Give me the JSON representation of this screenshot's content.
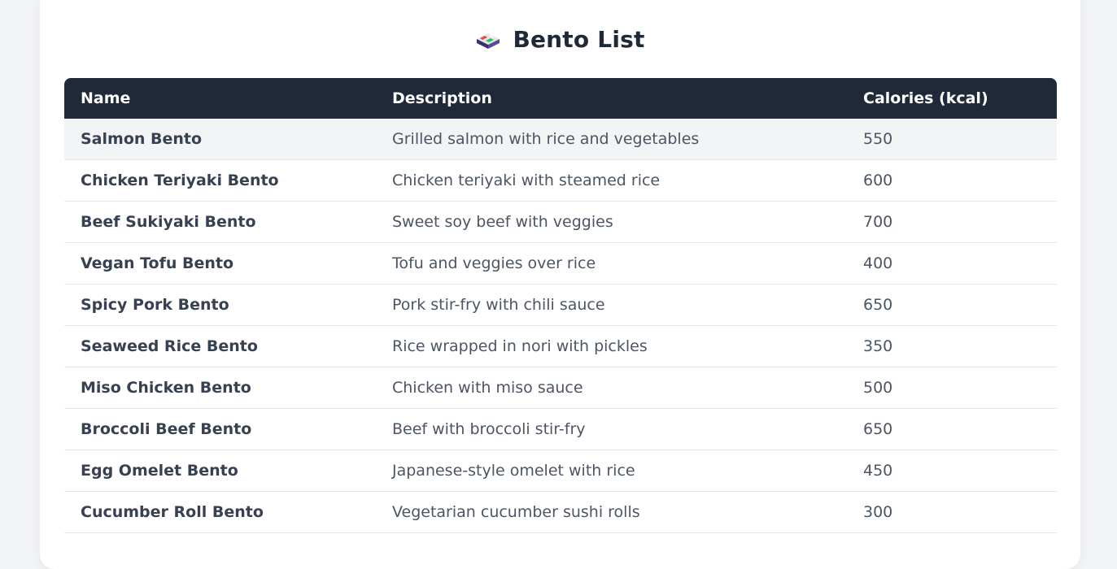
{
  "page": {
    "title": "Bento List",
    "icon": "bento-box-icon"
  },
  "table": {
    "headers": {
      "name": "Name",
      "description": "Description",
      "calories": "Calories (kcal)"
    },
    "rows": [
      {
        "name": "Salmon Bento",
        "description": "Grilled salmon with rice and vegetables",
        "calories": "550"
      },
      {
        "name": "Chicken Teriyaki Bento",
        "description": "Chicken teriyaki with steamed rice",
        "calories": "600"
      },
      {
        "name": "Beef Sukiyaki Bento",
        "description": "Sweet soy beef with veggies",
        "calories": "700"
      },
      {
        "name": "Vegan Tofu Bento",
        "description": "Tofu and veggies over rice",
        "calories": "400"
      },
      {
        "name": "Spicy Pork Bento",
        "description": "Pork stir-fry with chili sauce",
        "calories": "650"
      },
      {
        "name": "Seaweed Rice Bento",
        "description": "Rice wrapped in nori with pickles",
        "calories": "350"
      },
      {
        "name": "Miso Chicken Bento",
        "description": "Chicken with miso sauce",
        "calories": "500"
      },
      {
        "name": "Broccoli Beef Bento",
        "description": "Beef with broccoli stir-fry",
        "calories": "650"
      },
      {
        "name": "Egg Omelet Bento",
        "description": "Japanese-style omelet with rice",
        "calories": "450"
      },
      {
        "name": "Cucumber Roll Bento",
        "description": "Vegetarian cucumber sushi rolls",
        "calories": "300"
      }
    ]
  },
  "colors": {
    "header_bg": "#1f2937",
    "row_alt_bg": "#f3f4f6",
    "page_bg": "#f3f4f6"
  }
}
